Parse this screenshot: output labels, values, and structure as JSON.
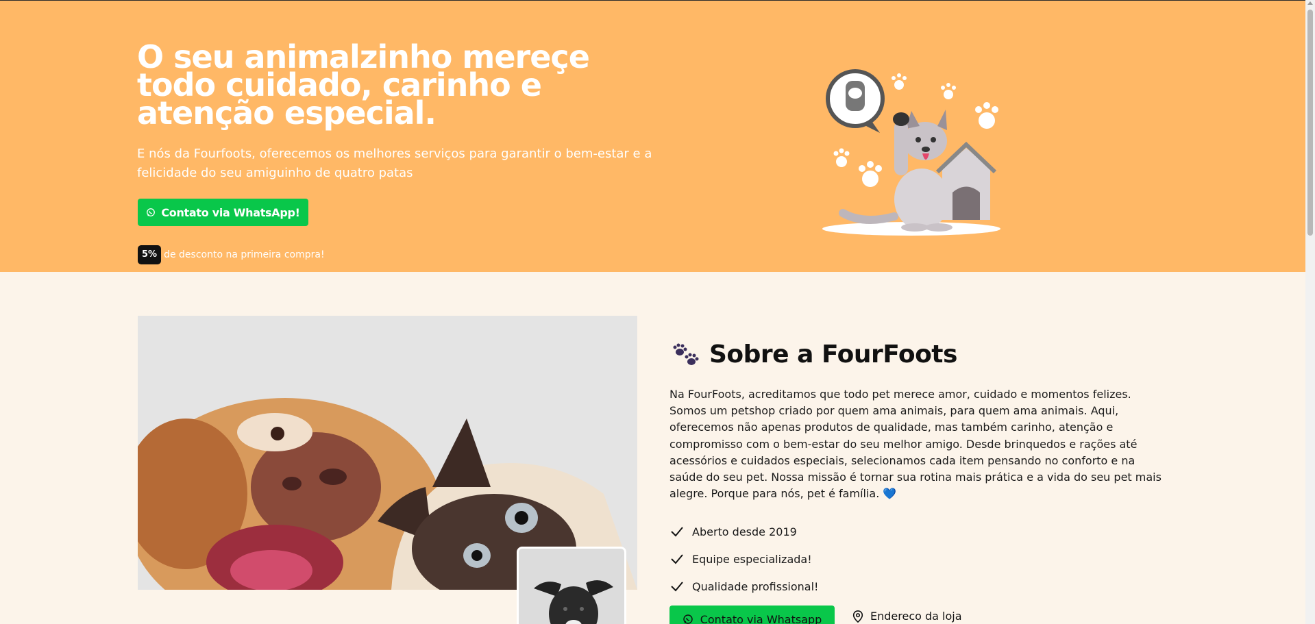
{
  "hero": {
    "title": "O seu animalzinho mereçe todo cuidado, carinho e atenção especial.",
    "subtitle": "E nós da Fourfoots, oferecemos os melhores serviços para garantir o bem-estar e a felicidade do seu amiguinho de quatro patas",
    "whatsapp_button": "Contato via WhatsApp!",
    "promo_badge": "5%",
    "promo_text": "de desconto na primeira compra!",
    "colors": {
      "background": "#ffb866",
      "button": "#09c74a"
    }
  },
  "about": {
    "title": "Sobre a FourFoots",
    "title_icon": "paw-prints-icon",
    "paragraph": "Na FourFoots, acreditamos que todo pet merece amor, cuidado e momentos felizes. Somos um petshop criado por quem ama animais, para quem ama animais. Aqui, oferecemos não apenas produtos de qualidade, mas também carinho, atenção e compromisso com o bem-estar do seu melhor amigo. Desde brinquedos e rações até acessórios e cuidados especiais, selecionamos cada item pensando no conforto e na saúde do seu pet. Nossa missão é tornar sua rotina mais prática e a vida do seu pet mais alegre. Porque para nós, pet é família. 💙",
    "checks": [
      {
        "label": "Aberto desde 2019"
      },
      {
        "label": "Equipe especializada!"
      },
      {
        "label": "Qualidade profissional!"
      }
    ],
    "whatsapp_button": "Contato via Whatsapp",
    "address_link": "Endereco da loja",
    "colors": {
      "background": "#fcf4ea"
    }
  }
}
